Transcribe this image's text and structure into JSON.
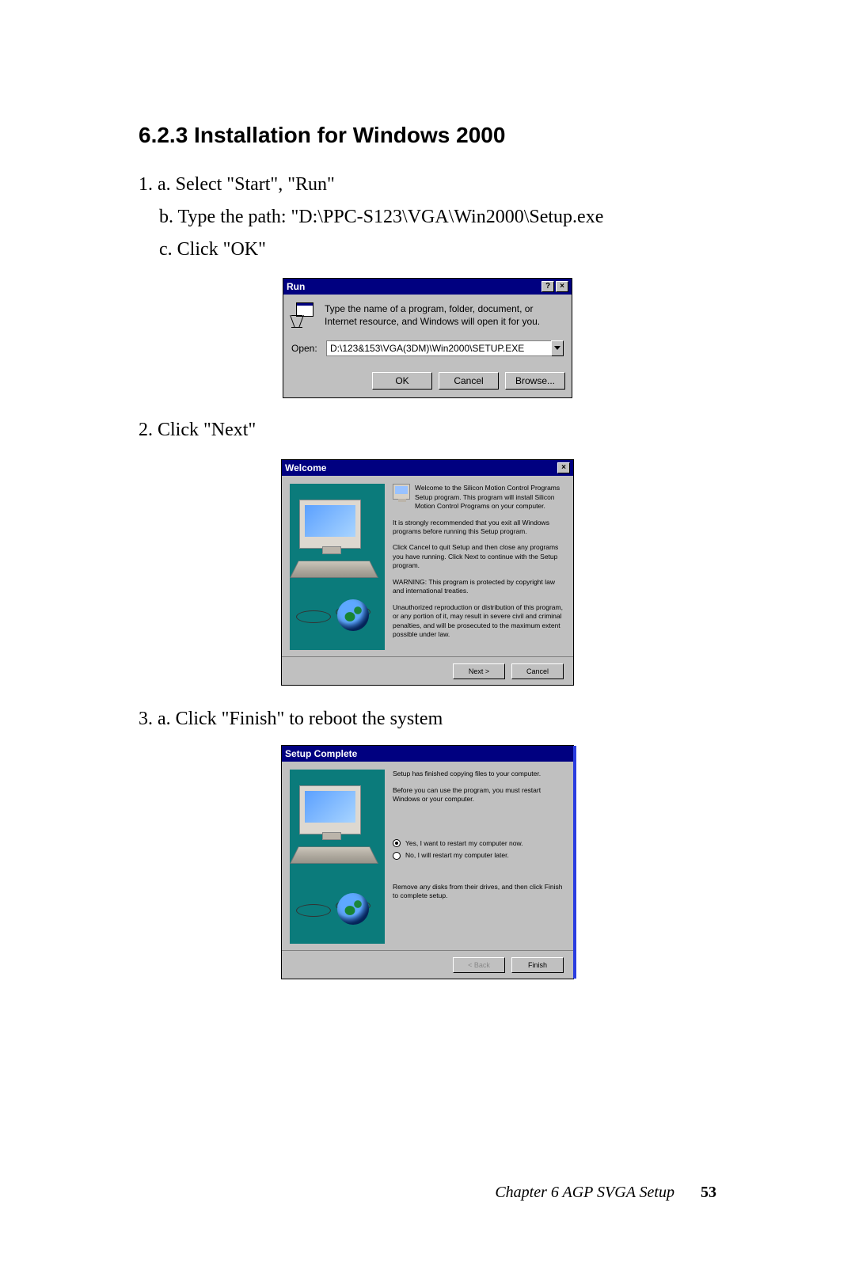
{
  "heading": "6.2.3 Installation for Windows 2000",
  "step1a": "1. a. Select \"Start\", \"Run\"",
  "step1b": "b. Type the path: \"D:\\PPC-S123\\VGA\\Win2000\\Setup.exe",
  "step1c": "c. Click \"OK\"",
  "step2": "2. Click \"Next\"",
  "step3": "3. a. Click \"Finish\" to reboot the system",
  "run": {
    "title": "Run",
    "desc": "Type the name of a program, folder, document, or Internet resource, and Windows will open it for you.",
    "openLabel": "Open:",
    "openValue": "D:\\123&153\\VGA(3DM)\\Win2000\\SETUP.EXE",
    "ok": "OK",
    "cancel": "Cancel",
    "browse": "Browse..."
  },
  "welcome": {
    "title": "Welcome",
    "p1": "Welcome to the Silicon Motion Control Programs Setup program. This program will install Silicon Motion Control Programs on your computer.",
    "p2": "It is strongly recommended that you exit all Windows programs before running this Setup program.",
    "p3": "Click Cancel to quit Setup and then close any programs you have running. Click Next to continue with the Setup program.",
    "p4": "WARNING: This program is protected by copyright law and international treaties.",
    "p5": "Unauthorized reproduction or distribution of this program, or any portion of it, may result in severe civil and criminal penalties, and will be prosecuted to the maximum extent possible under law.",
    "next": "Next >",
    "cancel": "Cancel"
  },
  "complete": {
    "title": "Setup Complete",
    "p1": "Setup has finished copying files to your computer.",
    "p2": "Before you can use the program, you must restart Windows or your computer.",
    "r1": "Yes, I want to restart my computer now.",
    "r2": "No, I will restart my computer later.",
    "p3": "Remove any disks from their drives, and then click Finish to complete setup.",
    "back": "< Back",
    "finish": "Finish"
  },
  "footer": {
    "chapter": "Chapter 6   AGP SVGA Setup",
    "page": "53"
  }
}
